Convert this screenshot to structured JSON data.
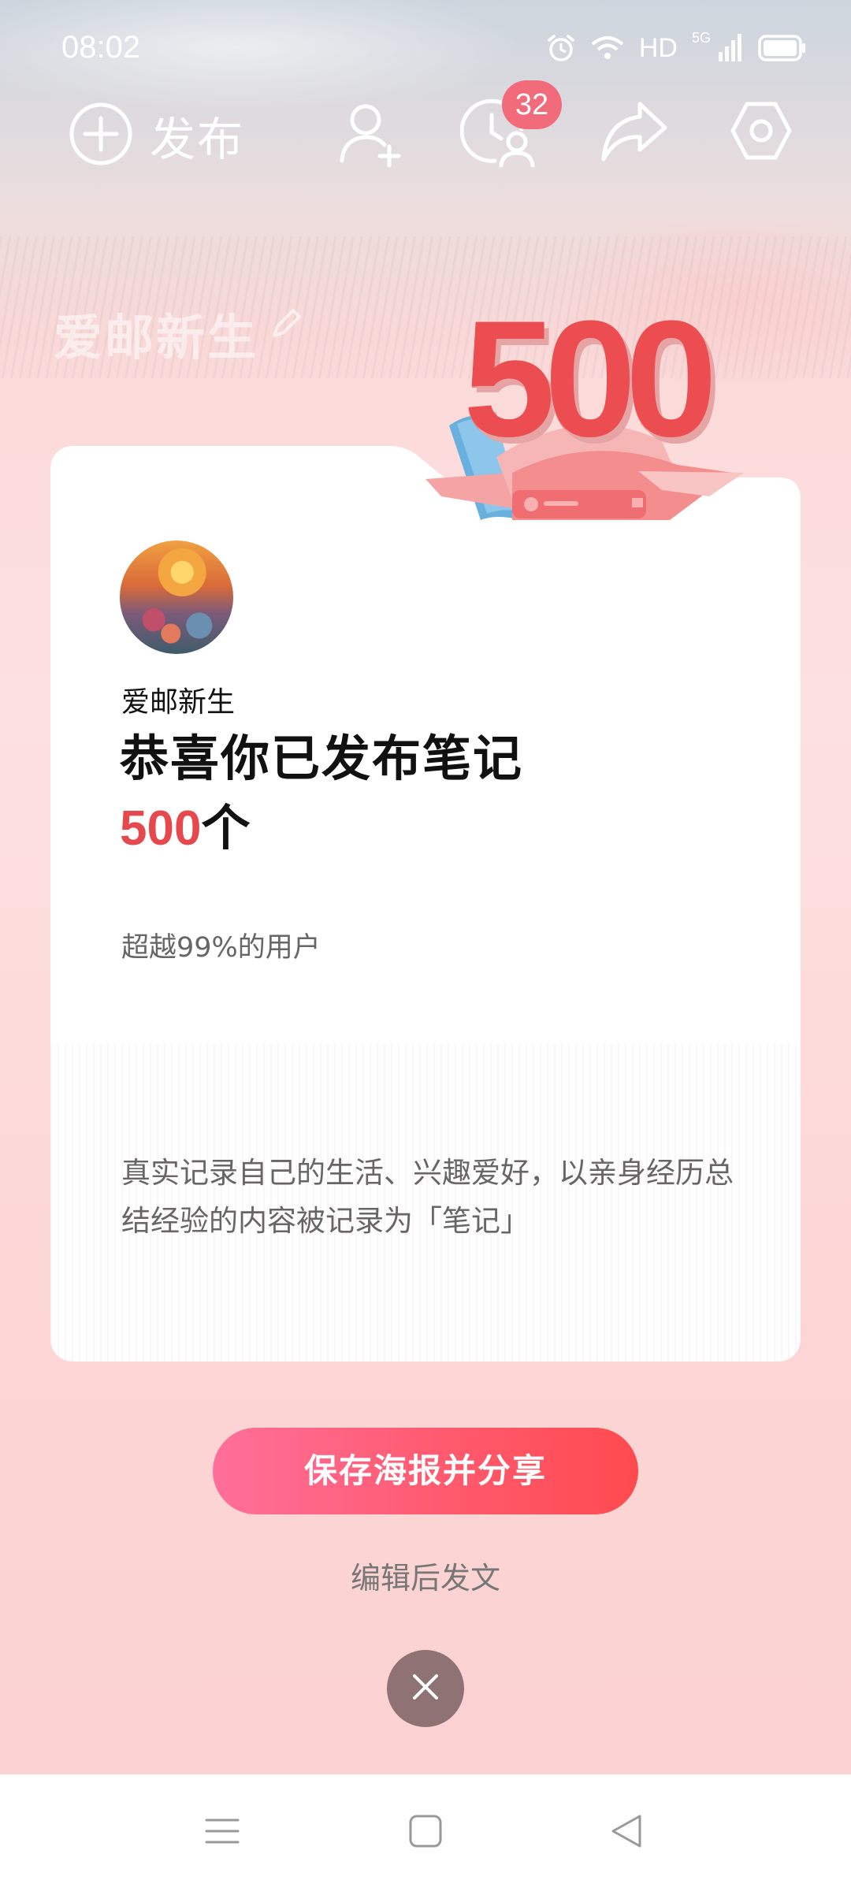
{
  "status_bar": {
    "time": "08:02",
    "network": "HD",
    "generation": "5G"
  },
  "toolbar": {
    "publish_label": "发布",
    "notification_count": "32",
    "icons": [
      "plus-circle-icon",
      "add-friend-icon",
      "visitors-icon",
      "share-icon",
      "settings-icon"
    ]
  },
  "profile": {
    "username": "爱邮新生"
  },
  "trophy": {
    "number": "500"
  },
  "card": {
    "username": "爱邮新生",
    "headline": "恭喜你已发布笔记",
    "count": "500",
    "unit": "个",
    "rank_text": "超越99%的用户",
    "description": "真实记录自己的生活、兴趣爱好，以亲身经历总结经验的内容被记录为「笔记」"
  },
  "actions": {
    "share_label": "保存海报并分享",
    "edit_label": "编辑后发文"
  },
  "navbar": {
    "buttons": [
      "menu-icon",
      "home-icon",
      "back-icon"
    ]
  },
  "colors": {
    "accent": "#e5484d",
    "button_gradient_start": "#ff6f9a",
    "button_gradient_end": "#ff4a4f",
    "badge": "#f26b7a",
    "close_button": "#8f7273"
  }
}
